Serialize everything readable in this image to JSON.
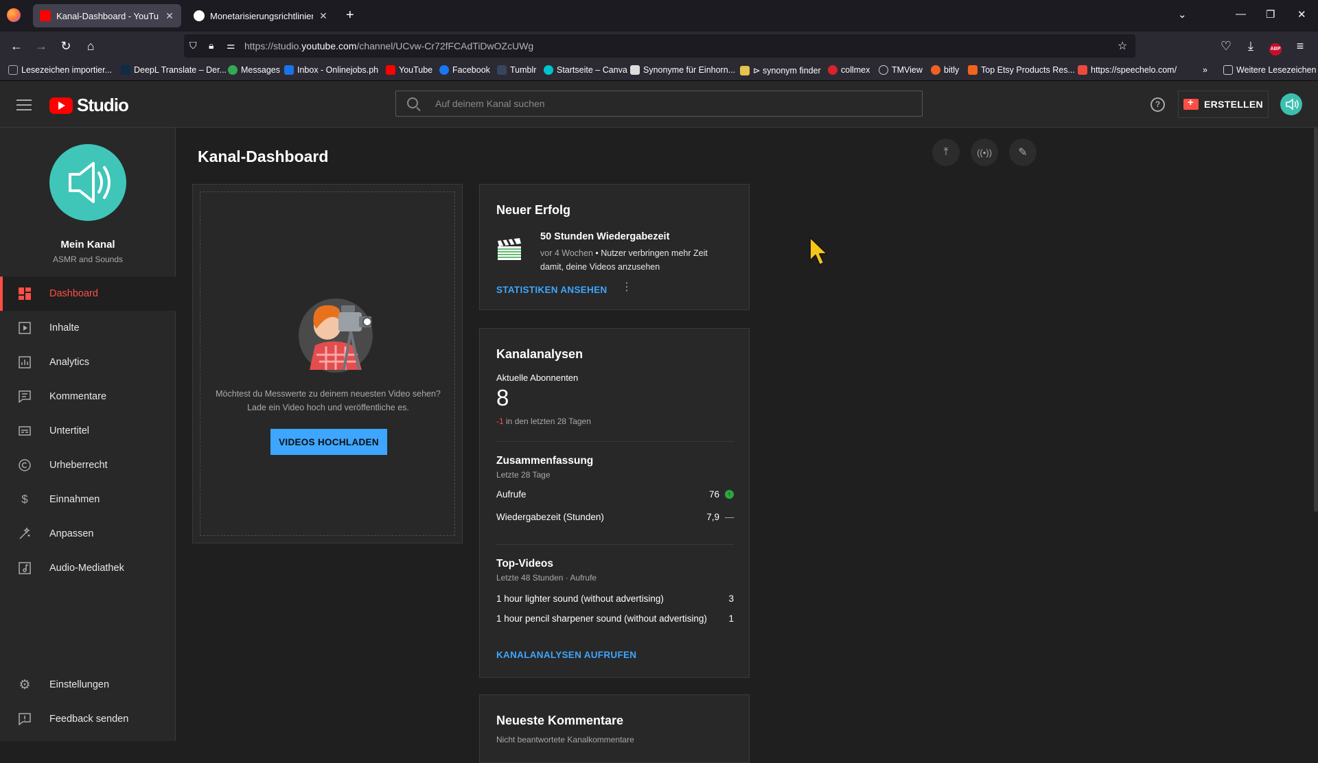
{
  "browser": {
    "tabs": [
      {
        "title": "Kanal-Dashboard - YouTube Studio",
        "active": true
      },
      {
        "title": "Monetarisierungsrichtlinien von YouTube",
        "active": false
      }
    ],
    "url_prefix": "https://studio.",
    "url_domain": "youtube.com",
    "url_path": "/channel/UCvw-Cr72fFCAdTiDwOZcUWg",
    "bookmarks": [
      "Lesezeichen importier...",
      "DeepL Translate – Der...",
      "Messages",
      "Inbox - Onlinejobs.ph",
      "YouTube",
      "Facebook",
      "Tumblr",
      "Startseite – Canva",
      "Synonyme für Einhorn...",
      "⊳ synonym finder",
      "collmex",
      "TMView",
      "bitly",
      "Top Etsy Products Res...",
      "https://speechelo.com/"
    ],
    "other_bookmarks": "Weitere Lesezeichen"
  },
  "header": {
    "logo_text": "Studio",
    "search_placeholder": "Auf deinem Kanal suchen",
    "create_label": "ERSTELLEN"
  },
  "sidebar": {
    "channel_name": "Mein Kanal",
    "channel_sub": "ASMR and Sounds",
    "items": [
      {
        "label": "Dashboard",
        "icon": "dashboard-icon",
        "active": true
      },
      {
        "label": "Inhalte",
        "icon": "content-icon"
      },
      {
        "label": "Analytics",
        "icon": "analytics-icon"
      },
      {
        "label": "Kommentare",
        "icon": "comments-icon"
      },
      {
        "label": "Untertitel",
        "icon": "subtitles-icon"
      },
      {
        "label": "Urheberrecht",
        "icon": "copyright-icon"
      },
      {
        "label": "Einnahmen",
        "icon": "dollar-icon"
      },
      {
        "label": "Anpassen",
        "icon": "magic-wand-icon"
      },
      {
        "label": "Audio-Mediathek",
        "icon": "audio-library-icon"
      }
    ],
    "bottom_items": [
      {
        "label": "Einstellungen",
        "icon": "gear-icon"
      },
      {
        "label": "Feedback senden",
        "icon": "feedback-icon"
      }
    ]
  },
  "main": {
    "title": "Kanal-Dashboard",
    "upload_card": {
      "text": "Möchtest du Messwerte zu deinem neuesten Video sehen? Lade ein Video hoch und veröffentliche es.",
      "button": "VIDEOS HOCHLADEN"
    },
    "milestone_card": {
      "title": "Neuer Erfolg",
      "item_title": "50 Stunden Wiedergabezeit",
      "item_time": "vor 4 Wochen",
      "item_desc": "Nutzer verbringen mehr Zeit damit, deine Videos anzusehen",
      "link": "STATISTIKEN ANSEHEN"
    },
    "analytics_card": {
      "title": "Kanalanalysen",
      "subs_label": "Aktuelle Abonnenten",
      "subs_value": "8",
      "subs_change": "-1",
      "subs_change_suffix": "in den letzten 28 Tagen",
      "summary_title": "Zusammenfassung",
      "summary_sub": "Letzte 28 Tage",
      "summary_rows": [
        {
          "label": "Aufrufe",
          "value": "76",
          "trend": "up"
        },
        {
          "label": "Wiedergabezeit (Stunden)",
          "value": "7,9",
          "trend": "flat"
        }
      ],
      "top_title": "Top-Videos",
      "top_sub": "Letzte 48 Stunden · Aufrufe",
      "top_rows": [
        {
          "label": "1 hour lighter sound (without advertising)",
          "value": "3"
        },
        {
          "label": "1 hour pencil sharpener sound (without advertising)",
          "value": "1"
        }
      ],
      "link": "KANALANALYSEN AUFRUFEN"
    },
    "comments_card": {
      "title": "Neueste Kommentare",
      "sub": "Nicht beantwortete Kanalkommentare"
    }
  },
  "colors": {
    "accent_red": "#ff4e45",
    "link_blue": "#3ea6ff",
    "positive_green": "#2ba640"
  }
}
